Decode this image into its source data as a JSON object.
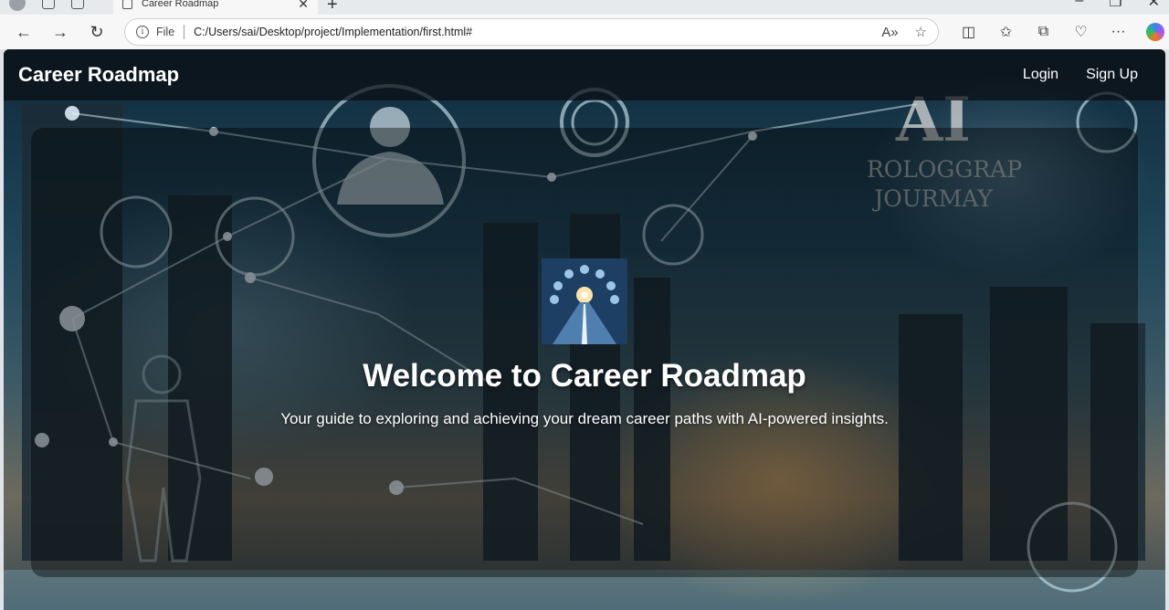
{
  "browser": {
    "tab_title": "Career Roadmap",
    "address_scheme": "File",
    "address_url": "C:/Users/sai/Desktop/project/Implementation/first.html#"
  },
  "site": {
    "brand": "Career Roadmap",
    "nav": {
      "login": "Login",
      "signup": "Sign Up"
    },
    "hero": {
      "title": "Welcome to Career Roadmap",
      "subtitle": "Your guide to exploring and achieving your dream career paths with AI-powered insights."
    },
    "background_text": {
      "ai": "AI",
      "line1": "ROLOGGRAP",
      "line2": "JOURMAY"
    }
  },
  "colors": {
    "nav_bg": "#0a0e14",
    "text": "#ffffff",
    "accent_glow": "#ffbe6e"
  }
}
